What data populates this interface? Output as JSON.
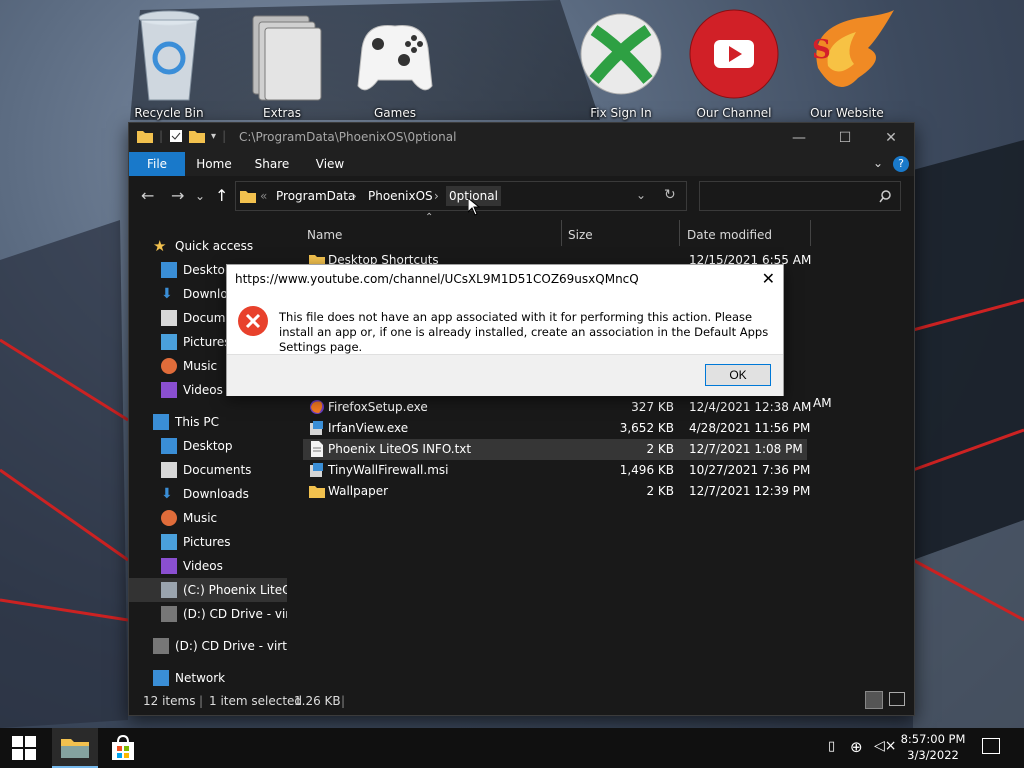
{
  "desktop": {
    "icons": [
      {
        "label": "Recycle Bin"
      },
      {
        "label": "Extras"
      },
      {
        "label": "Games"
      },
      {
        "label": "Fix Sign In"
      },
      {
        "label": "Our Channel"
      },
      {
        "label": "Our Website"
      }
    ]
  },
  "explorer": {
    "title_path": "C:\\ProgramData\\PhoenixOS\\0ptional",
    "ribbon_tabs": [
      "File",
      "Home",
      "Share",
      "View"
    ],
    "address": {
      "separator": "«",
      "crumbs": [
        "ProgramData",
        "PhoenixOS",
        "0ptional"
      ]
    },
    "search_placeholder": "",
    "nav": {
      "quick_access": "Quick access",
      "quick_items": [
        "Desktop",
        "Downloads",
        "Documents",
        "Pictures",
        "Music",
        "Videos"
      ],
      "this_pc": "This PC",
      "pc_items": [
        "Desktop",
        "Documents",
        "Downloads",
        "Music",
        "Pictures",
        "Videos",
        "(C:) Phoenix LiteOS",
        "(D:) CD Drive - virtio-win"
      ],
      "drive_d": "(D:) CD Drive - virtio-win",
      "network": "Network"
    },
    "columns": {
      "name": "Name",
      "size": "Size",
      "date": "Date modified"
    },
    "files": [
      {
        "name": "Desktop Shortcuts",
        "size": "",
        "date": "12/15/2021 6:55 AM",
        "icon": "folder-icon"
      },
      {
        "name": "FirefoxSetup.exe",
        "size": "327 KB",
        "date": "12/4/2021 12:38 AM",
        "icon": "firefox-icon"
      },
      {
        "name": "IrfanView.exe",
        "size": "3,652 KB",
        "date": "4/28/2021 11:56 PM",
        "icon": "installer-icon"
      },
      {
        "name": "Phoenix LiteOS INFO.txt",
        "size": "2 KB",
        "date": "12/7/2021 1:08 PM",
        "icon": "text-file-icon"
      },
      {
        "name": "TinyWallFirewall.msi",
        "size": "1,496 KB",
        "date": "10/27/2021 7:36 PM",
        "icon": "installer-icon"
      },
      {
        "name": "Wallpaper",
        "size": "2 KB",
        "date": "12/7/2021 12:39 PM",
        "icon": "folder-icon"
      }
    ],
    "hidden_dates": [
      "12/15/2021 6:55 AM",
      "AM",
      "AM",
      "AM",
      "AM",
      "AM"
    ],
    "status": {
      "items": "12 items",
      "selected": "1 item selected",
      "size": "1.26 KB"
    }
  },
  "dialog": {
    "title": "https://www.youtube.com/channel/UCsXL9M1D51COZ69usxQMncQ",
    "message": "This file does not have an app associated with it for performing this action. Please install an app or, if one is already installed, create an association in the Default Apps Settings page.",
    "ok_label": "OK"
  },
  "taskbar": {
    "time": "8:57:00 PM",
    "date": "3/3/2022"
  },
  "colors": {
    "accent": "#1979ca",
    "error": "#e8412c",
    "window_bg": "#191919"
  }
}
